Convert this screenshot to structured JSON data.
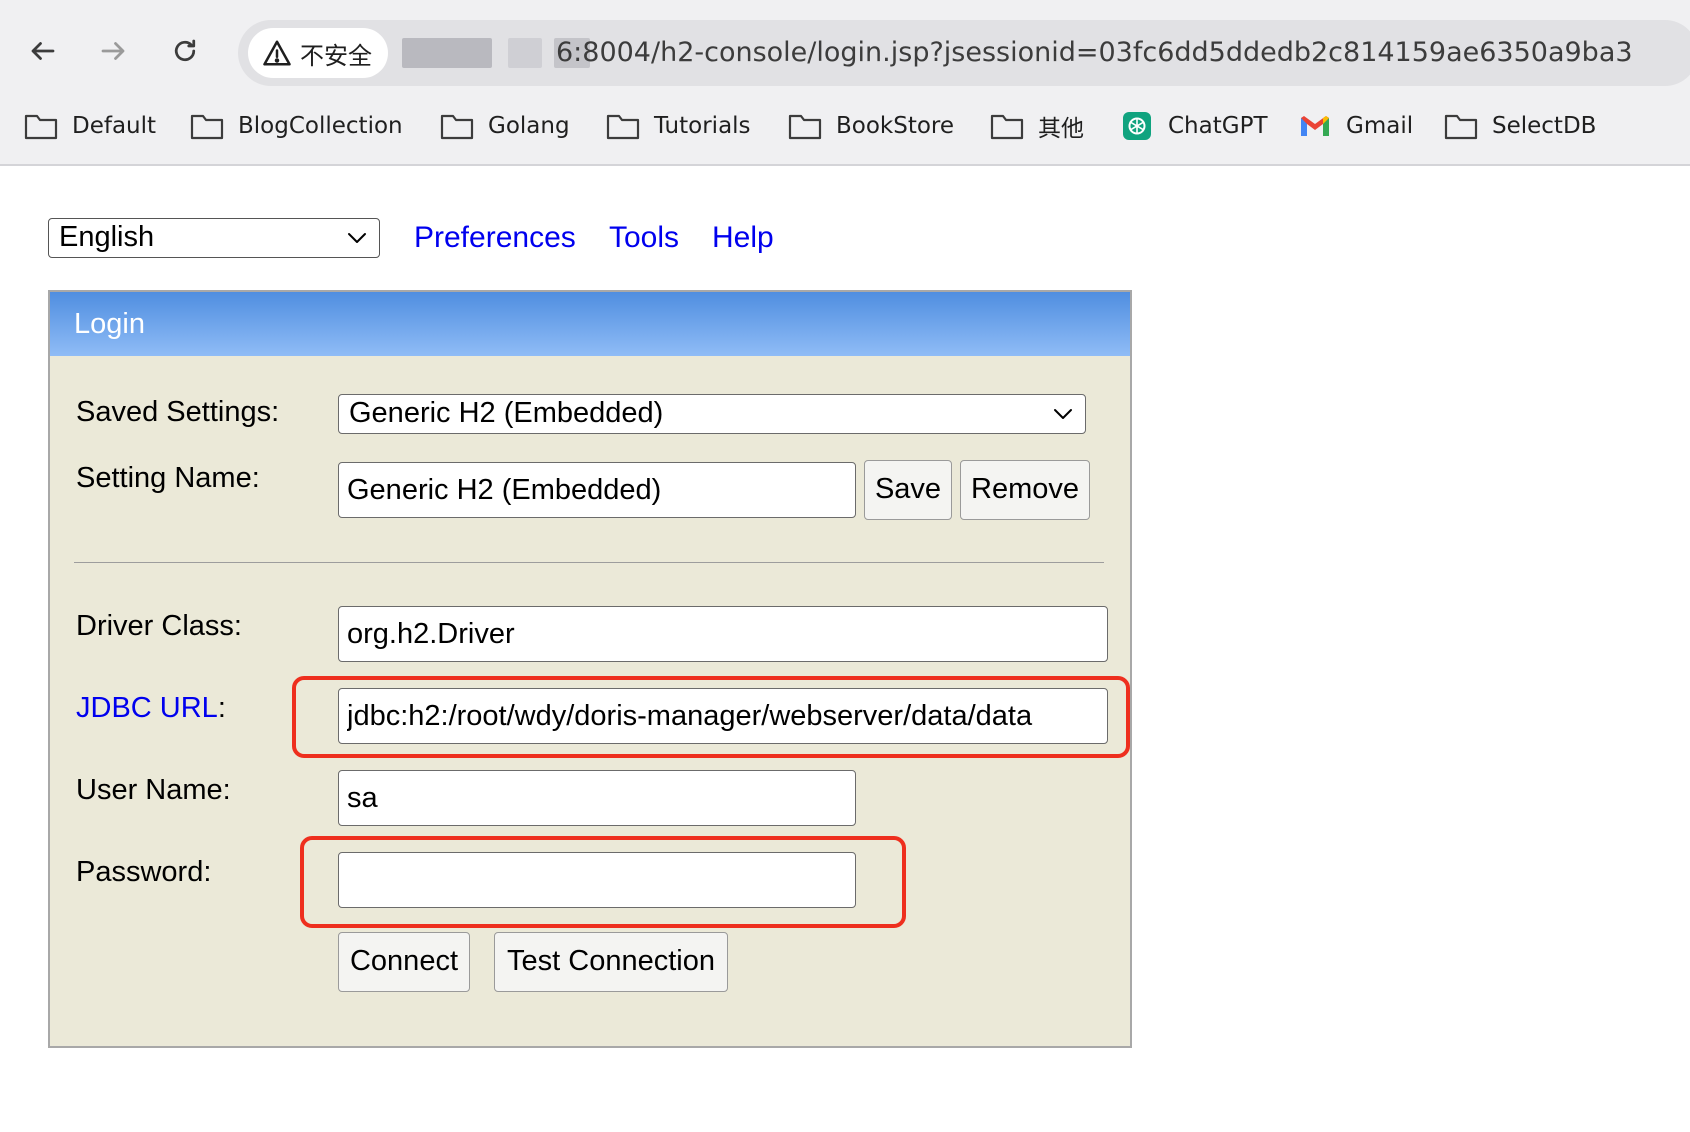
{
  "browser": {
    "security_label": "不安全",
    "url_visible": "6:8004/h2-console/login.jsp?jsessionid=03fc6dd5ddedb2c814159ae6350a9ba3",
    "bookmarks": [
      "Default",
      "BlogCollection",
      "Golang",
      "Tutorials",
      "BookStore",
      "其他",
      "ChatGPT",
      "Gmail",
      "SelectDB"
    ]
  },
  "top": {
    "language": "English",
    "links": [
      "Preferences",
      "Tools",
      "Help"
    ]
  },
  "login": {
    "title": "Login",
    "saved_settings_label": "Saved Settings:",
    "saved_settings_value": "Generic H2 (Embedded)",
    "setting_name_label": "Setting Name:",
    "setting_name_value": "Generic H2 (Embedded)",
    "save_label": "Save",
    "remove_label": "Remove",
    "driver_class_label": "Driver Class:",
    "driver_class_value": "org.h2.Driver",
    "jdbc_url_link": "JDBC URL",
    "jdbc_url_colon": ":",
    "jdbc_url_value": "jdbc:h2:/root/wdy/doris-manager/webserver/data/data",
    "user_name_label": "User Name:",
    "user_name_value": "sa",
    "password_label": "Password:",
    "password_value": "",
    "connect_label": "Connect",
    "test_connection_label": "Test Connection"
  },
  "colors": {
    "header_gradient_top": "#4f8ee0",
    "header_gradient_bottom": "#8fbcf6",
    "panel_bg": "#ebe9d8",
    "link": "#0000ee",
    "highlight": "#ee2f1e"
  }
}
